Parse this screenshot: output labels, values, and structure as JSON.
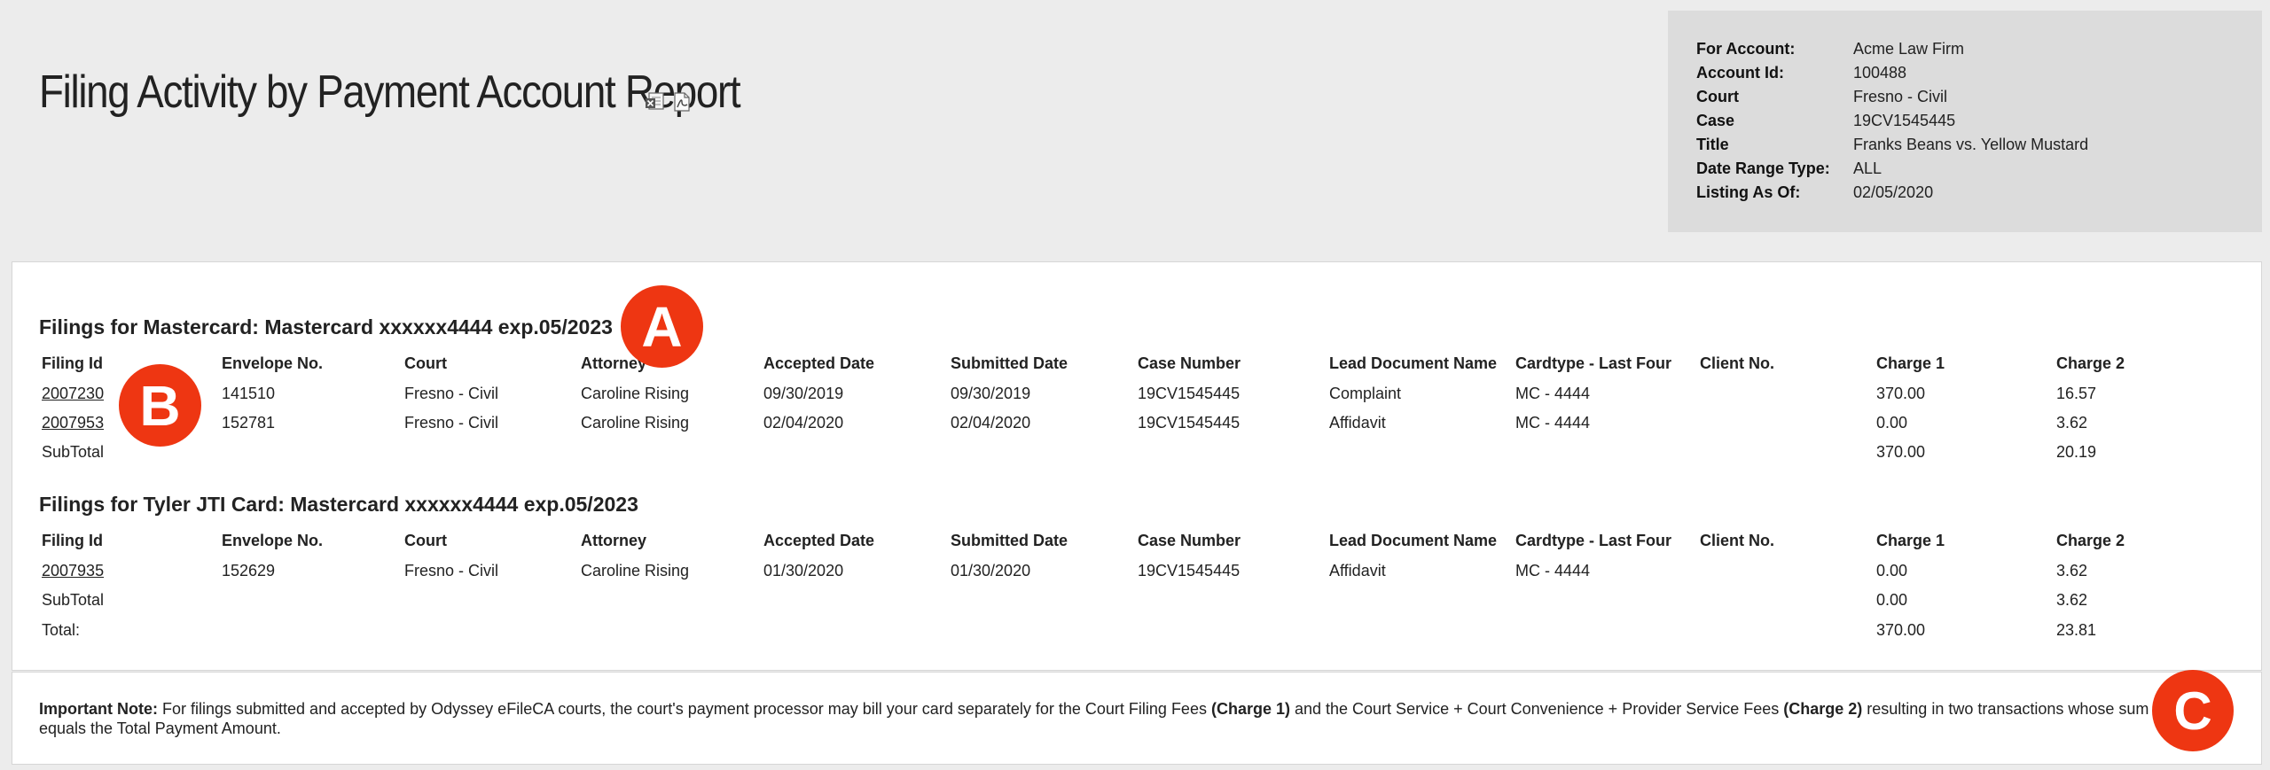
{
  "header": {
    "title": "Filing Activity by Payment Account Report",
    "icons": [
      "excel-export-icon",
      "pdf-export-icon"
    ]
  },
  "info": [
    {
      "label": "For Account:",
      "value": "Acme Law Firm"
    },
    {
      "label": "Account Id:",
      "value": "100488"
    },
    {
      "label": "Court",
      "value": "Fresno - Civil"
    },
    {
      "label": "Case",
      "value": "19CV1545445"
    },
    {
      "label": "Title",
      "value": "Franks Beans vs. Yellow Mustard"
    },
    {
      "label": "Date Range Type:",
      "value": "ALL"
    },
    {
      "label": "Listing As Of:",
      "value": "02/05/2020"
    }
  ],
  "columns": [
    "Filing Id",
    "Envelope No.",
    "Court",
    "Attorney",
    "Accepted Date",
    "Submitted Date",
    "Case Number",
    "Lead Document Name",
    "Cardtype - Last Four",
    "Client No.",
    "Charge 1",
    "Charge 2"
  ],
  "sections": [
    {
      "heading": "Filings for Mastercard: Mastercard xxxxxx4444 exp.05/2023",
      "rows": [
        [
          "2007230",
          "141510",
          "Fresno - Civil",
          "Caroline Rising",
          "09/30/2019",
          "09/30/2019",
          "19CV1545445",
          "Complaint",
          "MC - 4444",
          "",
          "370.00",
          "16.57"
        ],
        [
          "2007953",
          "152781",
          "Fresno - Civil",
          "Caroline Rising",
          "02/04/2020",
          "02/04/2020",
          "19CV1545445",
          "Affidavit",
          "MC - 4444",
          "",
          "0.00",
          "3.62"
        ]
      ],
      "subtotal": {
        "label": "SubTotal",
        "charge1": "370.00",
        "charge2": "20.19"
      }
    },
    {
      "heading": "Filings for Tyler JTI Card: Mastercard xxxxxx4444 exp.05/2023",
      "rows": [
        [
          "2007935",
          "152629",
          "Fresno - Civil",
          "Caroline Rising",
          "01/30/2020",
          "01/30/2020",
          "19CV1545445",
          "Affidavit",
          "MC - 4444",
          "",
          "0.00",
          "3.62"
        ]
      ],
      "subtotal": {
        "label": "SubTotal",
        "charge1": "0.00",
        "charge2": "3.62"
      }
    }
  ],
  "total": {
    "label": "Total:",
    "charge1": "370.00",
    "charge2": "23.81"
  },
  "note": {
    "label": "Important Note:",
    "part1": " For filings submitted and accepted by Odyssey eFileCA courts, the court's payment processor may bill your card separately for the Court Filing Fees ",
    "bold1": "(Charge 1)",
    "part2": " and the Court Service + Court Convenience + Provider Service Fees ",
    "bold2": "(Charge 2)",
    "part3": " resulting in two transactions whose sum equals the Total Payment Amount."
  },
  "callouts": {
    "a": "A",
    "b": "B",
    "c": "C"
  },
  "colors": {
    "callout": "#ee3612",
    "background": "#ececec",
    "info_box": "#dcdcdc"
  }
}
